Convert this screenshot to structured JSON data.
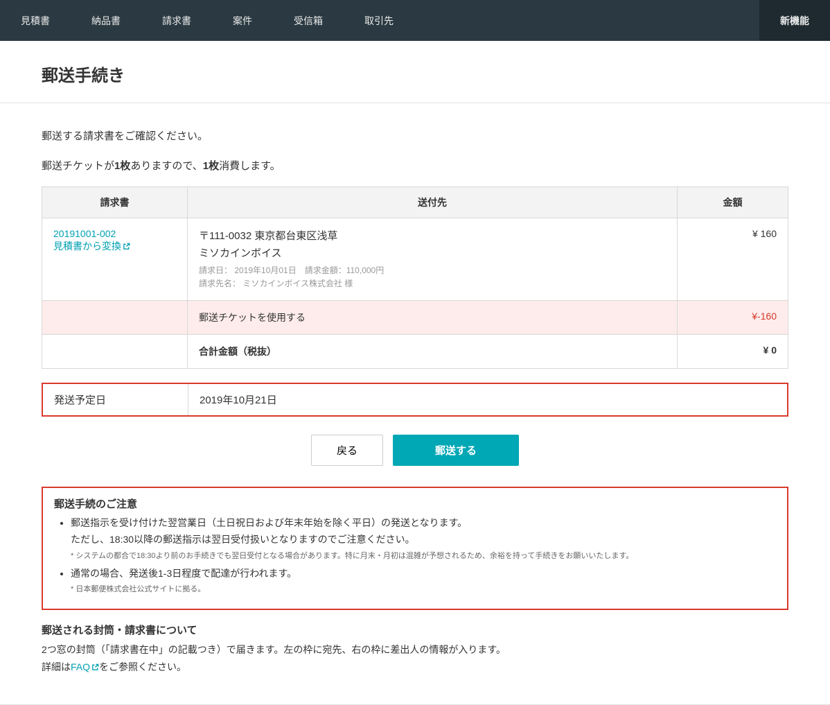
{
  "nav": {
    "items": [
      "見積書",
      "納品書",
      "請求書",
      "案件",
      "受信箱",
      "取引先"
    ],
    "new_feature": "新機能"
  },
  "page": {
    "title": "郵送手続き",
    "confirm": "郵送する請求書をご確認ください。",
    "ticket_line_prefix": "郵送チケットが",
    "ticket_line_count": "1枚",
    "ticket_line_mid": "ありますので、",
    "ticket_line_consume": "1枚",
    "ticket_line_suffix": "消費します。"
  },
  "table": {
    "headers": {
      "invoice": "請求書",
      "destination": "送付先",
      "amount": "金額"
    },
    "row": {
      "invoice_no": "20191001-002",
      "convert_label": "見積書から変換",
      "address": "〒111-0032 東京都台東区浅草",
      "recipient": "ミソカインボイス",
      "meta_line1": "請求日： 2019年10月01日　請求金額：110,000円",
      "meta_line2": "請求先名： ミソカインボイス株式会社 様",
      "amount": "¥ 160"
    },
    "ticket_row": {
      "label": "郵送チケットを使用する",
      "amount": "¥-160"
    },
    "total": {
      "label": "合計金額（税抜）",
      "amount": "¥ 0"
    }
  },
  "ship_date": {
    "label": "発送予定日",
    "value": "2019年10月21日"
  },
  "actions": {
    "back": "戻る",
    "submit": "郵送する"
  },
  "notice": {
    "title": "郵送手続のご注意",
    "item1": "郵送指示を受け付けた翌営業日（土日祝日および年末年始を除く平日）の発送となります。",
    "item1b": "ただし、18:30以降の郵送指示は翌日受付扱いとなりますのでご注意ください。",
    "note1": "* システムの都合で18:30より前のお手続きでも翌日受付となる場合があります。特に月末・月初は混雑が予想されるため、余裕を持って手続きをお願いいたします。",
    "item2": "通常の場合、発送後1-3日程度で配達が行われます。",
    "note2": "* 日本郵便株式会社公式サイトに拠る。"
  },
  "envelope": {
    "title": "郵送される封筒・請求書について",
    "text1": "2つ窓の封筒（「請求書在中」の記載つき）で届きます。左の枠に宛先、右の枠に差出人の情報が入ります。",
    "text2_prefix": "詳細は",
    "faq_label": "FAQ",
    "text2_suffix": "をご参照ください。"
  }
}
